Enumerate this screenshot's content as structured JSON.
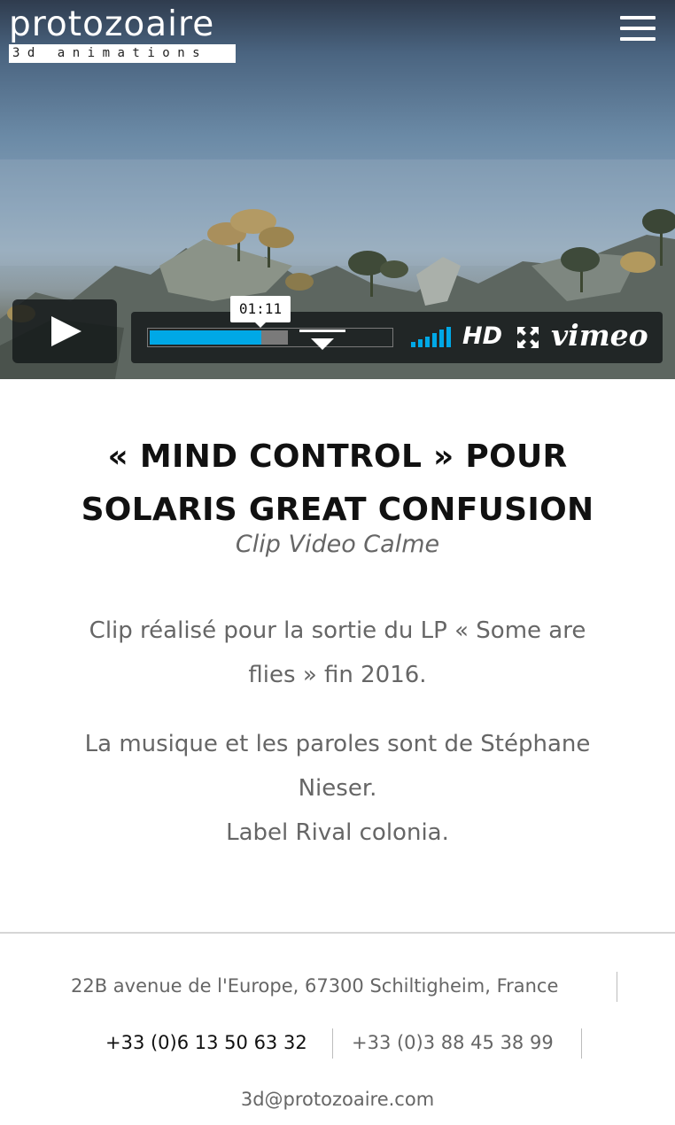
{
  "header": {
    "logo_word": "protozoaire",
    "logo_tagline": "3d animations",
    "menu_icon": "hamburger-menu-icon"
  },
  "player": {
    "play_icon": "play-icon",
    "current_time": "01:11",
    "progress_fraction": 0.46,
    "buffered_fraction": 0.57,
    "volume_icon": "volume-bars-icon",
    "hd_label": "HD",
    "fullscreen_icon": "fullscreen-icon",
    "brand_label": "vimeo",
    "accent_color": "#00a8e6"
  },
  "article": {
    "title_line1": "« MIND CONTROL » POUR",
    "title_line2": "SOLARIS GREAT CONFUSION",
    "subtitle": "Clip Video Calme",
    "para1_line1": "Clip réalisé pour la sortie du LP « Some are",
    "para1_line2": "flies » fin 2016.",
    "para2_line1": "La musique et les paroles sont de Stéphane",
    "para2_line2": "Nieser.",
    "para2_line3": "Label Rival colonia."
  },
  "footer": {
    "address": "22B avenue de l'Europe, 67300 Schiltigheim, France",
    "phone_mobile": "+33 (0)6 13 50 63 32",
    "phone_landline": "+33 (0)3 88 45 38 99",
    "email": "3d@protozoaire.com"
  }
}
